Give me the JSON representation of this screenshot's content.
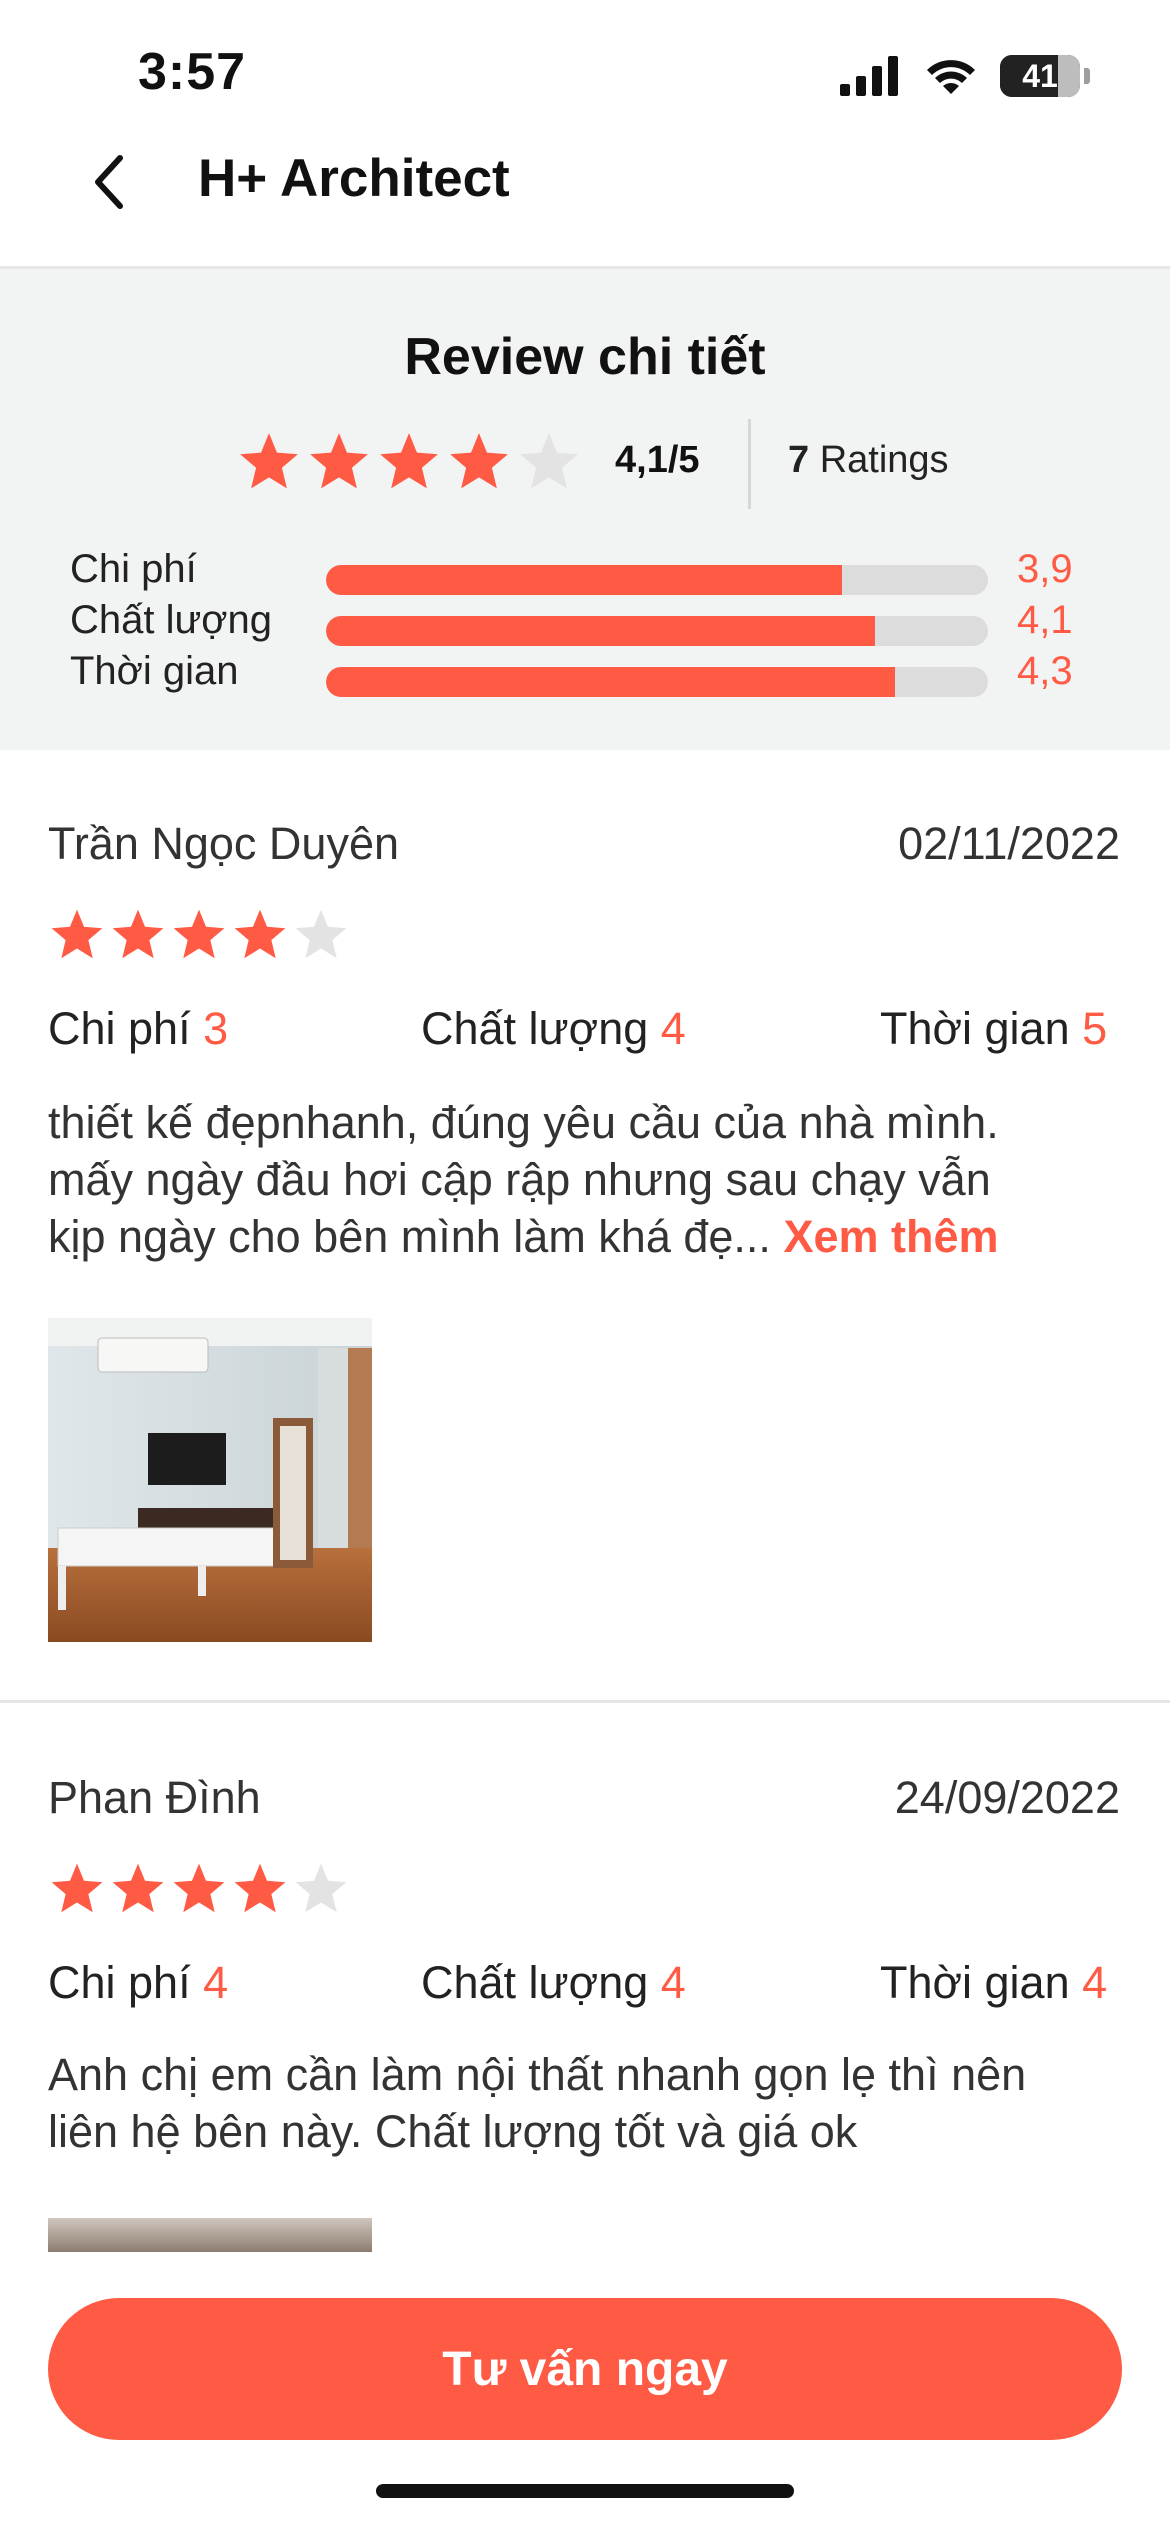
{
  "status_bar": {
    "time": "3:57",
    "battery": "41"
  },
  "header": {
    "title": "H+ Architect"
  },
  "summary": {
    "title": "Review chi tiết",
    "rating": 4.1,
    "score_text": "4,1/5",
    "ratings_count": "7",
    "ratings_label": "Ratings",
    "criteria": [
      {
        "label": "Chi phí",
        "value": "3,9",
        "fraction": 0.78
      },
      {
        "label": "Chất lượng",
        "value": "4,1",
        "fraction": 0.83
      },
      {
        "label": "Thời gian",
        "value": "4,3",
        "fraction": 0.86
      }
    ]
  },
  "reviews": [
    {
      "name": "Trần Ngọc Duyên",
      "date": "02/11/2022",
      "stars": 4,
      "criteria": [
        {
          "label": "Chi phí",
          "value": "3"
        },
        {
          "label": "Chất lượng",
          "value": "4"
        },
        {
          "label": "Thời gian",
          "value": "5"
        }
      ],
      "text_lines": [
        "thiết kế đẹpnhanh, đúng yêu cầu của nhà mình.",
        "mấy ngày đầu hơi cập rập nhưng sau chạy vẫn",
        "kịp ngày cho bên mình làm khá đẹ..."
      ],
      "see_more": "Xem thêm"
    },
    {
      "name": "Phan Đình",
      "date": "24/09/2022",
      "stars": 4,
      "criteria": [
        {
          "label": "Chi phí",
          "value": "4"
        },
        {
          "label": "Chất lượng",
          "value": "4"
        },
        {
          "label": "Thời gian",
          "value": "4"
        }
      ],
      "text_lines": [
        "Anh chị em cần làm nội thất nhanh gọn lẹ thì nên",
        "liên hệ bên này. Chất lượng tốt và giá ok"
      ]
    }
  ],
  "cta": {
    "label": "Tư vấn ngay"
  },
  "colors": {
    "accent": "#FF5A44",
    "star_empty": "#e3e3e3",
    "summary_bg": "#f2f3f3"
  },
  "icons": [
    "back-arrow-icon",
    "signal-icon",
    "wifi-icon",
    "battery-icon",
    "star-icon"
  ]
}
